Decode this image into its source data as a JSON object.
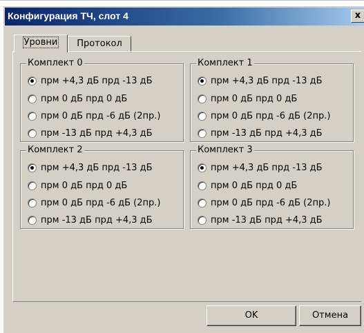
{
  "window": {
    "title": "Конфигурация ТЧ, слот 4",
    "close_label": "x"
  },
  "tabs": [
    {
      "label": "Уровни",
      "active": true
    },
    {
      "label": "Протокол",
      "active": false
    }
  ],
  "groups": [
    {
      "title": "Комплект 0",
      "options": [
        {
          "label": "прм +4,3 дБ  прд -13 дБ",
          "selected": true
        },
        {
          "label": "прм 0 дБ прд 0 дБ",
          "selected": false
        },
        {
          "label": "прм 0 дБ прд -6 дБ (2пр.)",
          "selected": false
        },
        {
          "label": "прм -13 дБ прд +4,3 дБ",
          "selected": false
        }
      ]
    },
    {
      "title": "Комплект 1",
      "options": [
        {
          "label": "прм +4,3 дБ  прд -13 дБ",
          "selected": true
        },
        {
          "label": "прм 0 дБ прд 0 дБ",
          "selected": false
        },
        {
          "label": "прм 0 дБ прд -6 дБ (2пр.)",
          "selected": false
        },
        {
          "label": "прм -13 дБ прд +4,3 дБ",
          "selected": false
        }
      ]
    },
    {
      "title": "Комплект 2",
      "options": [
        {
          "label": "прм +4,3 дБ  прд -13 дБ",
          "selected": true
        },
        {
          "label": "прм 0 дБ прд 0 дБ",
          "selected": false
        },
        {
          "label": "прм 0 дБ прд -6 дБ (2пр.)",
          "selected": false
        },
        {
          "label": "прм -13 дБ прд +4,3 дБ",
          "selected": false
        }
      ]
    },
    {
      "title": "Комплект 3",
      "options": [
        {
          "label": "прм +4,3 дБ  прд -13 дБ",
          "selected": true
        },
        {
          "label": "прм 0 дБ прд 0 дБ",
          "selected": false
        },
        {
          "label": "прм 0 дБ прд -6 дБ (2пр.)",
          "selected": false
        },
        {
          "label": "прм -13 дБ прд +4,3 дБ",
          "selected": false
        }
      ]
    }
  ],
  "buttons": {
    "ok_label": "OK",
    "cancel_label": "Отмена"
  }
}
